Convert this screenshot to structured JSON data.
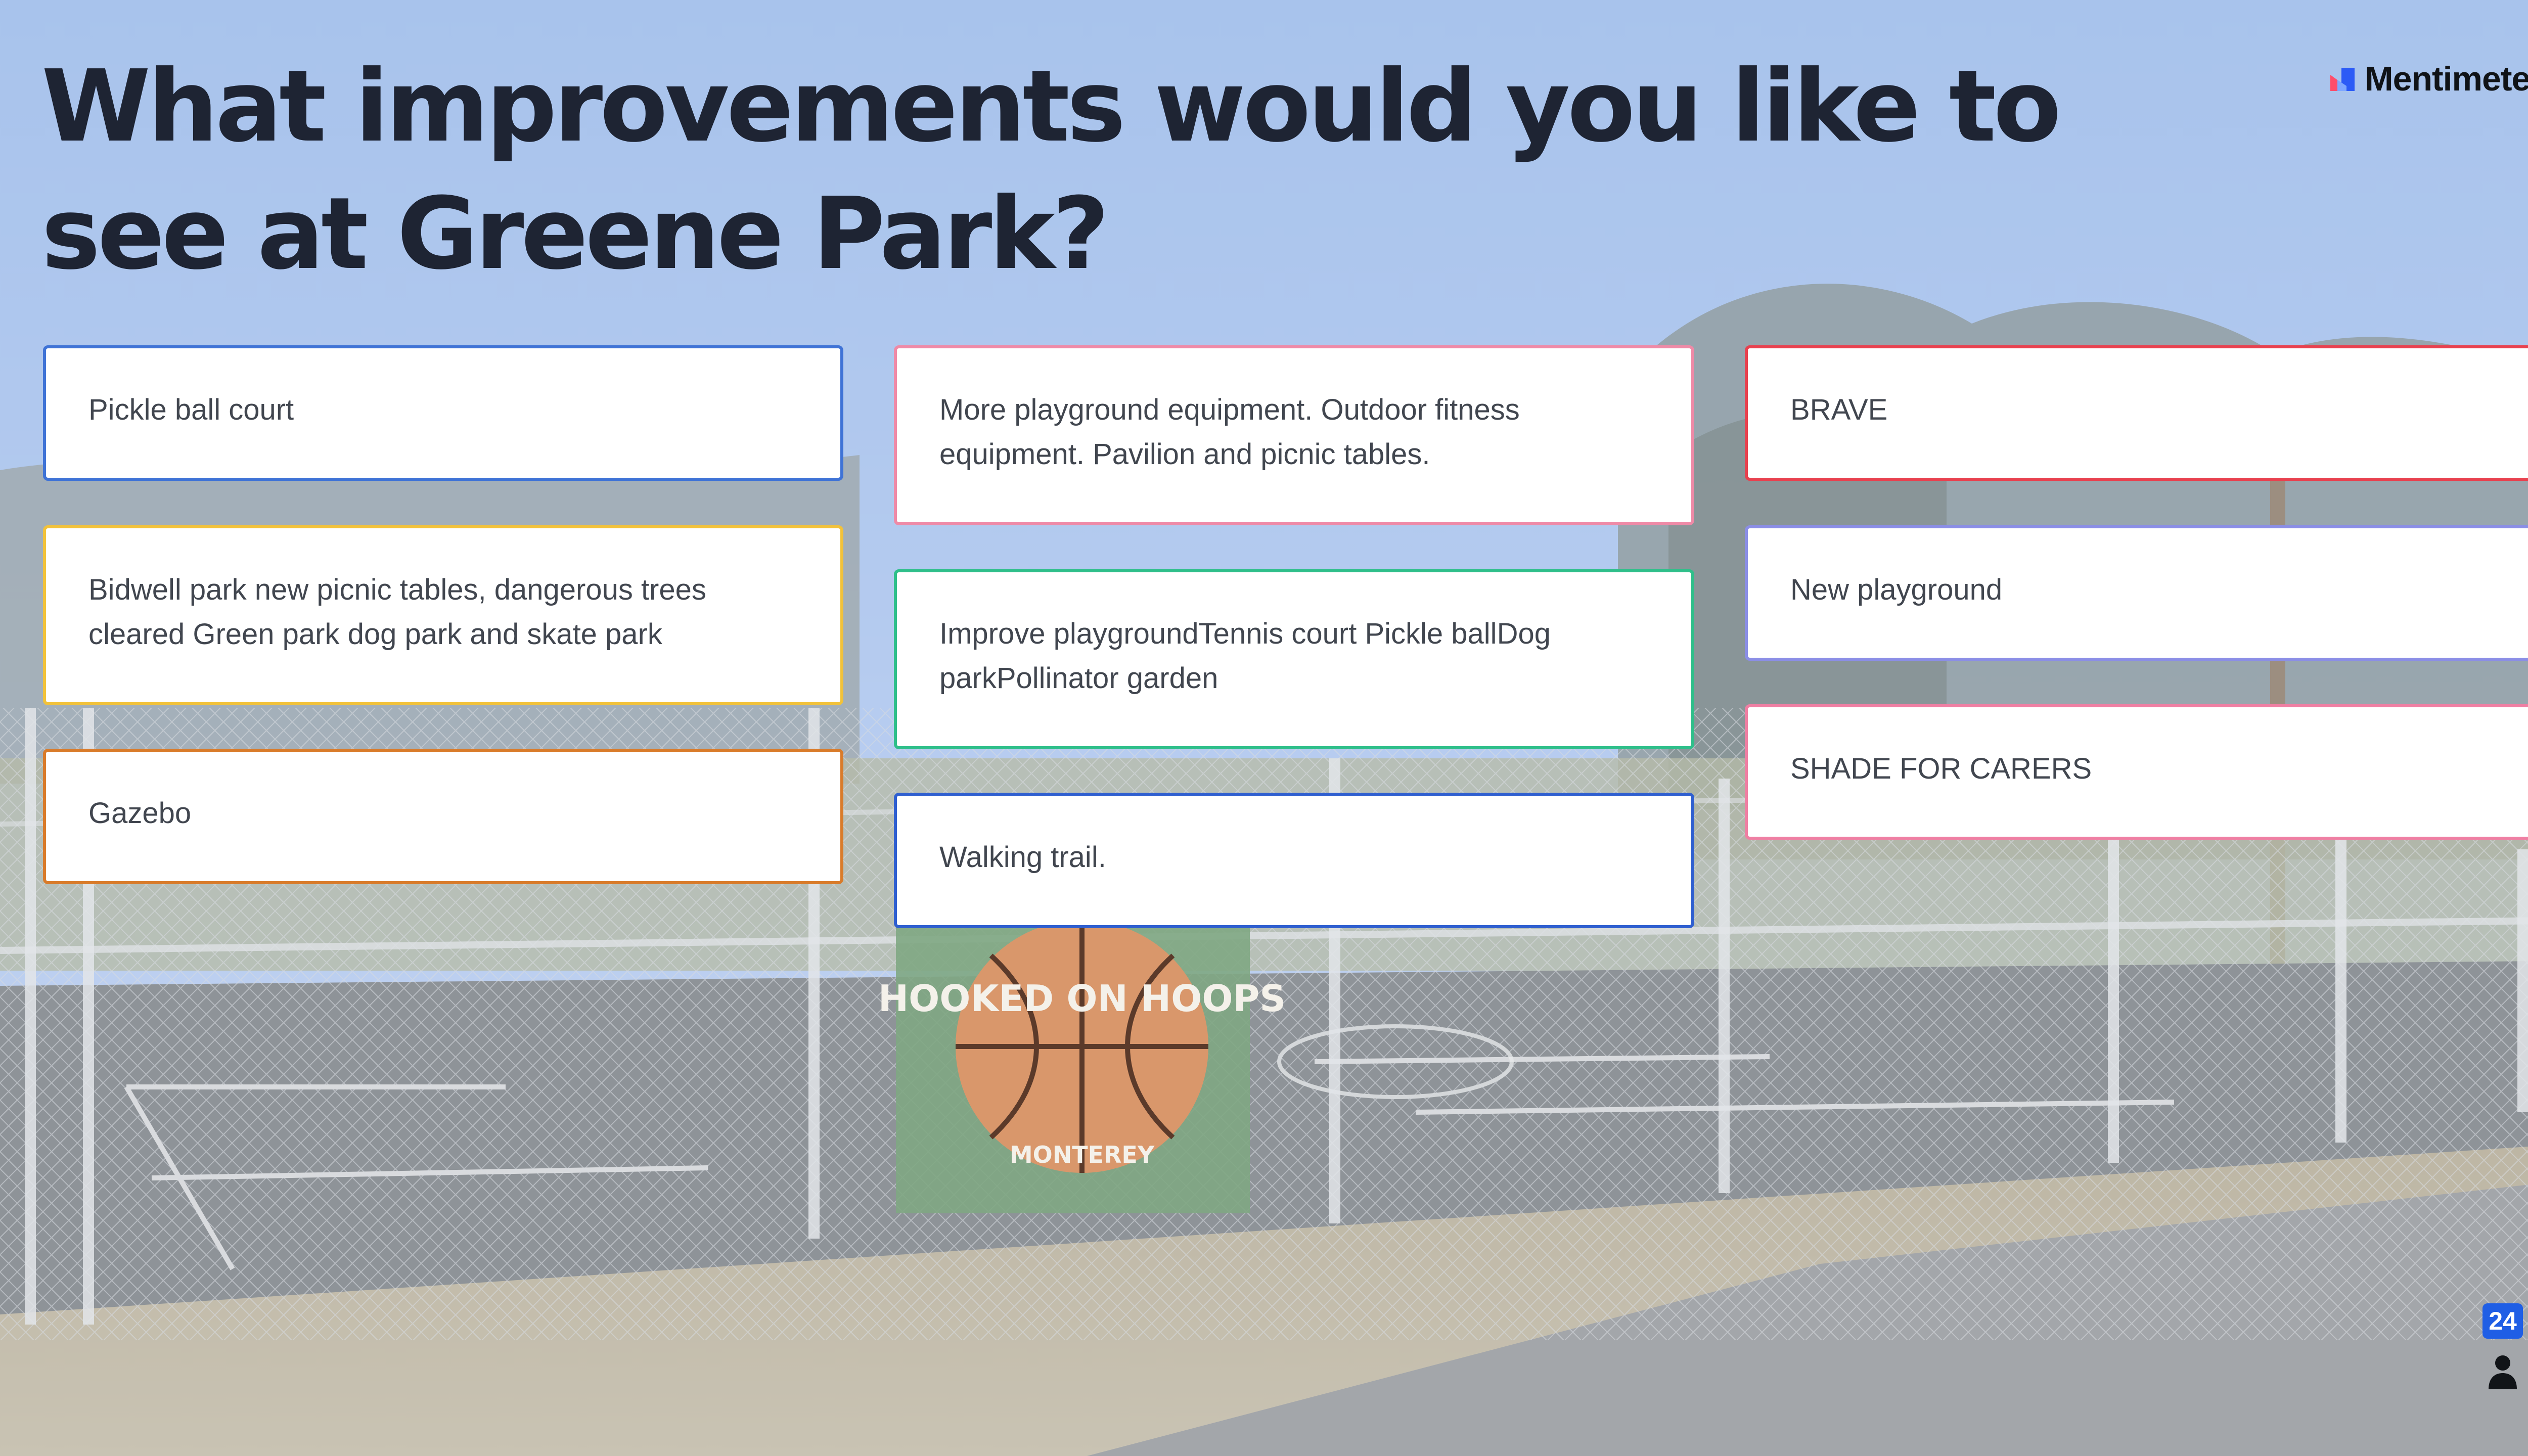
{
  "question": {
    "title": "What improvements would you like to see at Greene Park?"
  },
  "brand": {
    "name": "Mentimeter",
    "logo_icon": "mentimeter-logo-icon"
  },
  "responses": [
    {
      "text": "Pickle ball court",
      "border_color": "#3f73d6"
    },
    {
      "text": "Bidwell park new picnic tables, dangerous trees cleared Green park dog park and skate park",
      "border_color": "#f2c23a"
    },
    {
      "text": "Gazebo",
      "border_color": "#d97b2a"
    },
    {
      "text": "More playground equipment. Outdoor fitness equipment. Pavilion and picnic tables.",
      "border_color": "#ef8aa7"
    },
    {
      "text": "Improve playgroundTennis court Pickle ballDog parkPollinator garden",
      "border_color": "#2fbf8a"
    },
    {
      "text": "Walking trail.",
      "border_color": "#2f5fd0"
    },
    {
      "text": "BRAVE",
      "border_color": "#e8414f"
    },
    {
      "text": "New playground",
      "border_color": "#8b8ee6"
    },
    {
      "text": "SHADE FOR CARERS",
      "border_color": "#ef7fa3"
    }
  ],
  "participants": {
    "count": "24",
    "icon": "person-icon",
    "badge_color": "#1f5ee5"
  },
  "background": {
    "sign_text": "HOOKED ON HOOPS",
    "sign_subtext": "MONTEREY"
  }
}
